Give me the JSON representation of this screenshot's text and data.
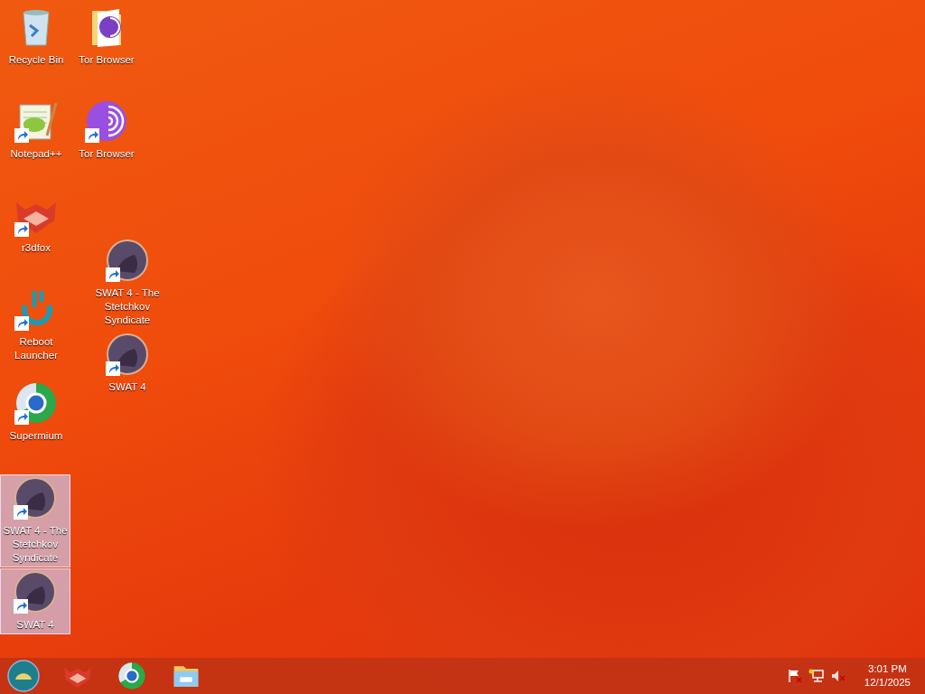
{
  "desktop_icons": [
    {
      "label": "Recycle Bin",
      "kind": "recycle-bin",
      "shortcut": false,
      "selected": false
    },
    {
      "label": "Tor Browser",
      "kind": "folder",
      "shortcut": false,
      "selected": false
    },
    {
      "label": "Notepad++",
      "kind": "notepad",
      "shortcut": true,
      "selected": false
    },
    {
      "label": "Tor Browser",
      "kind": "onion",
      "shortcut": true,
      "selected": false
    },
    {
      "label": "r3dfox",
      "kind": "fox",
      "shortcut": true,
      "selected": false
    },
    {
      "label": "SWAT 4 - The Stetchkov Syndicate",
      "kind": "game",
      "shortcut": true,
      "selected": false
    },
    {
      "label": "Reboot Launcher",
      "kind": "reboot",
      "shortcut": true,
      "selected": false
    },
    {
      "label": "SWAT 4",
      "kind": "game",
      "shortcut": true,
      "selected": false
    },
    {
      "label": "Supermium",
      "kind": "browser",
      "shortcut": true,
      "selected": false
    },
    {
      "label": "SWAT 4 - The Stetchkov Syndicate",
      "kind": "game",
      "shortcut": true,
      "selected": true
    },
    {
      "label": "SWAT 4",
      "kind": "game",
      "shortcut": true,
      "selected": true
    }
  ],
  "taskbar": {
    "pinned": [
      {
        "kind": "fox"
      },
      {
        "kind": "browser"
      },
      {
        "kind": "explorer"
      }
    ],
    "tray": [
      {
        "kind": "flag"
      },
      {
        "kind": "network"
      },
      {
        "kind": "volume-muted"
      }
    ],
    "clock": {
      "time": "3:01 PM",
      "date": "12/1/2025"
    }
  }
}
